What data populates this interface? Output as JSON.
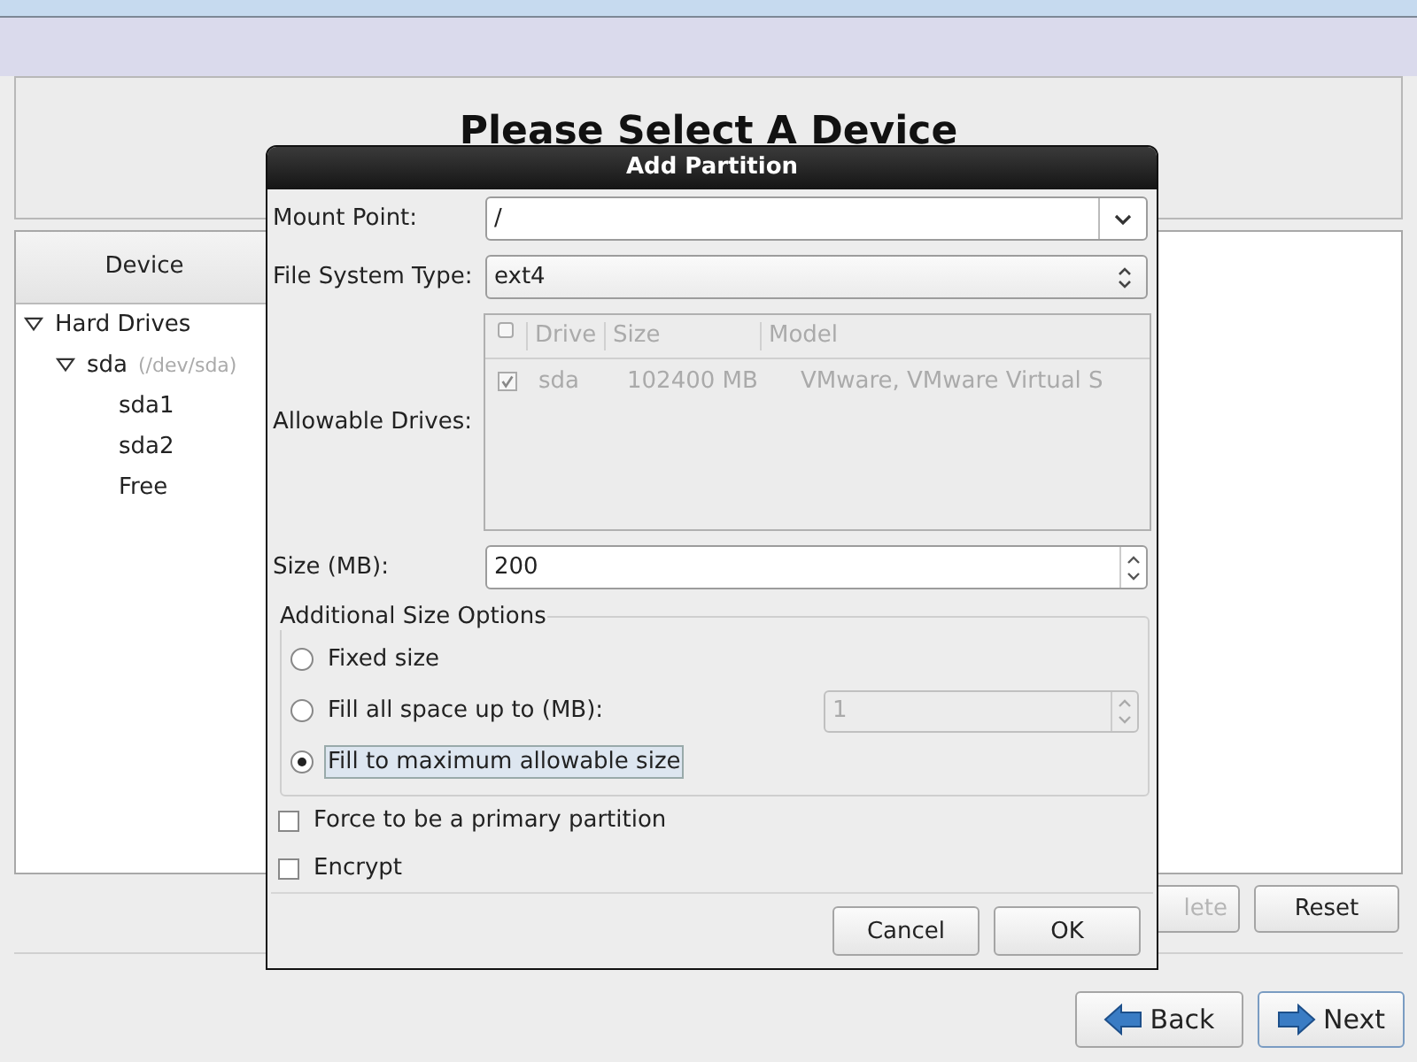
{
  "page": {
    "heading": "Please Select A Device"
  },
  "device_tree": {
    "column": "Device",
    "items": [
      {
        "label": "Hard Drives",
        "expanded": true,
        "children": [
          {
            "label": "sda",
            "detail": "(/dev/sda)",
            "expanded": true,
            "children": [
              {
                "label": "sda1"
              },
              {
                "label": "sda2"
              },
              {
                "label": "Free"
              }
            ]
          }
        ]
      }
    ]
  },
  "page_buttons": [
    {
      "label": "lete",
      "disabled": true
    },
    {
      "label": "Reset",
      "disabled": false
    }
  ],
  "nav_buttons": [
    {
      "label": "Back",
      "kind": "back"
    },
    {
      "label": "Next",
      "kind": "next"
    }
  ],
  "dialog": {
    "title": "Add Partition",
    "mount_point": {
      "label": "Mount Point:",
      "value": "/"
    },
    "file_system": {
      "label": "File System Type:",
      "value": "ext4"
    },
    "drives": {
      "label": "Allowable Drives:",
      "disabled": true,
      "header_checked": false,
      "columns": [
        "Drive",
        "Size",
        "Model"
      ],
      "rows": [
        {
          "checked": true,
          "drive": "sda",
          "size": "102400 MB",
          "model": "VMware, VMware Virtual S"
        }
      ]
    },
    "size": {
      "label": "Size (MB):",
      "value": "200"
    },
    "size_options": {
      "title": "Additional Size Options",
      "options": [
        {
          "label": "Fixed size",
          "selected": false,
          "focused": false
        },
        {
          "label": "Fill all space up to (MB):",
          "selected": false,
          "focused": false,
          "value": "1",
          "value_disabled": true
        },
        {
          "label": "Fill to maximum allowable size",
          "selected": true,
          "focused": true
        }
      ]
    },
    "checkboxes": [
      {
        "label": "Force to be a primary partition",
        "checked": false
      },
      {
        "label": "Encrypt",
        "checked": false
      }
    ],
    "buttons": [
      "Cancel",
      "OK"
    ]
  }
}
